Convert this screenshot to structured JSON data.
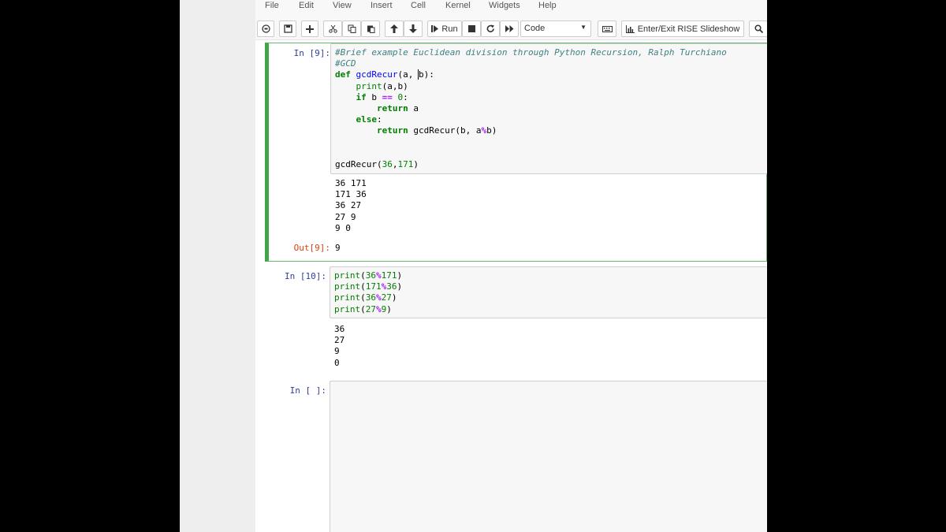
{
  "menu": [
    "File",
    "Edit",
    "View",
    "Insert",
    "Cell",
    "Kernel",
    "Widgets",
    "Help"
  ],
  "toolbar": {
    "run_label": "Run",
    "cell_type": "Code",
    "rise_label": "Enter/Exit RISE Slideshow"
  },
  "icons": {
    "save": "floppy-disk-icon",
    "add": "plus-icon",
    "cut": "scissors-icon",
    "copy": "copy-icon",
    "paste": "paste-icon",
    "up": "arrow-up-icon",
    "down": "arrow-down-icon",
    "run": "step-forward-icon",
    "stop": "stop-icon",
    "restart": "restart-icon",
    "run_all": "fast-forward-icon",
    "keyboard": "keyboard-icon",
    "rise": "bar-chart-icon",
    "zoom": "magnifier-icon"
  },
  "cells": [
    {
      "in_prompt": "In [9]:",
      "out_prompt": "Out[9]:",
      "stdout": "36 171\n171 36\n36 27\n27 9\n9 0",
      "result": "9"
    },
    {
      "in_prompt": "In [10]:",
      "stdout": "36\n27\n9\n0"
    },
    {
      "in_prompt": "In [ ]:"
    }
  ],
  "colors": {
    "selected_border": "#42a548",
    "in_prompt": "#303f9f",
    "out_prompt": "#d84315"
  }
}
